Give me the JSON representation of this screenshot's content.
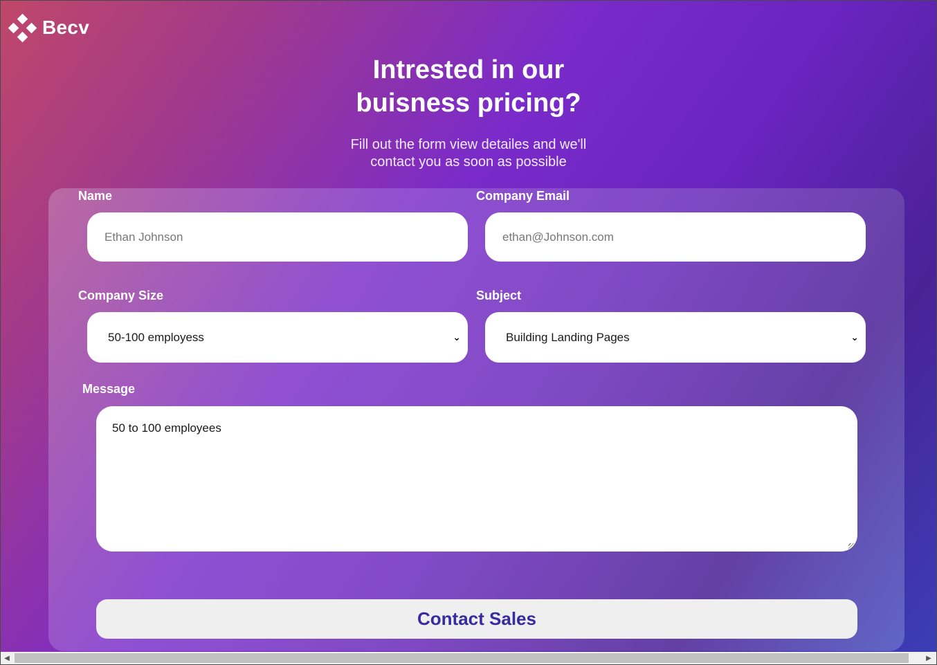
{
  "brand": {
    "name": "Becv",
    "icon": "diamond-cluster-logo-icon"
  },
  "hero": {
    "title_line1": "Intrested in our",
    "title_line2": "buisness pricing?",
    "subtitle_line1": "Fill out the form view detailes and we'll",
    "subtitle_line2": "contact you as soon as possible"
  },
  "form": {
    "name": {
      "label": "Name",
      "placeholder": "Ethan Johnson"
    },
    "email": {
      "label": "Company Email",
      "placeholder": "ethan@Johnson.com"
    },
    "company_size": {
      "label": "Company Size",
      "selected": "50-100 employess"
    },
    "subject": {
      "label": "Subject",
      "selected": "Building Landing Pages"
    },
    "message": {
      "label": "Message",
      "value": "50 to 100 employees"
    },
    "submit_label": "Contact Sales"
  },
  "scrollbar": {
    "left_icon": "triangle-left-icon",
    "right_icon": "triangle-right-icon"
  },
  "colors": {
    "gradient_start": "#c0476a",
    "gradient_mid": "#7a2bc9",
    "gradient_end": "#3a3fb8",
    "button_text": "#3a2aa0"
  }
}
